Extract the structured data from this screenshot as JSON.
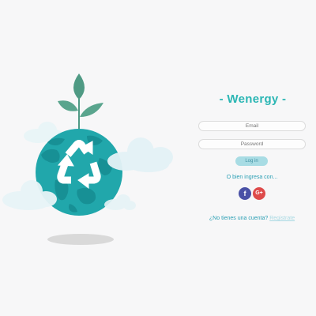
{
  "brand": {
    "title": "- Wenergy -"
  },
  "login": {
    "email_placeholder": "Email",
    "password_placeholder": "Password",
    "login_label": "Log in",
    "alt_text": "O bien ingresa con...",
    "facebook_label": "f",
    "google_label": "G+",
    "register_prompt": "¿No tienes una cuenta?",
    "register_link": "Registrate"
  },
  "colors": {
    "accent": "#2bb6b4",
    "globe": "#1fa5a8",
    "leaf": "#4f9a84",
    "facebook": "#4a51a6",
    "google": "#de4b4b"
  }
}
